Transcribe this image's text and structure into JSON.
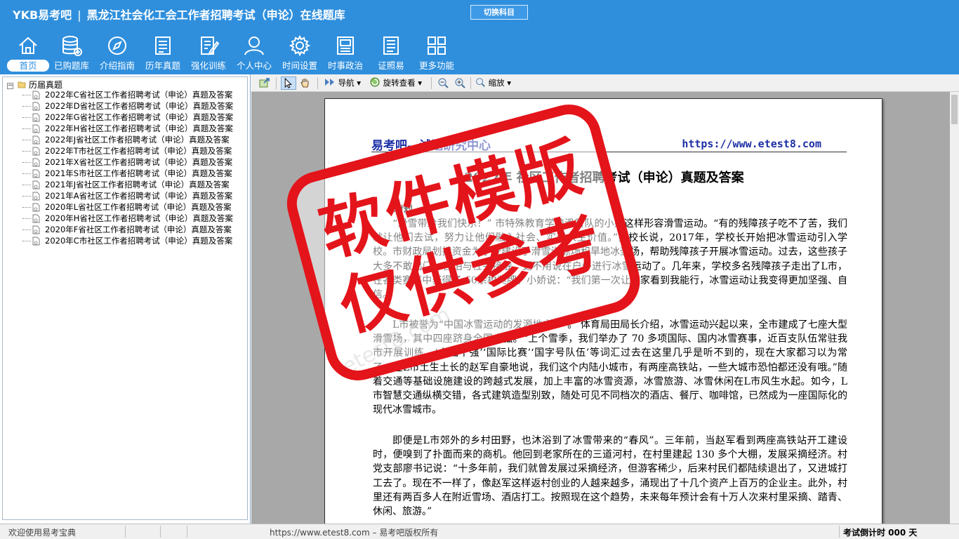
{
  "header": {
    "logo": "YKB易考吧",
    "title": "黑龙江社会化工会工作者招聘考试（申论）在线题库",
    "switch_label": "切换科目"
  },
  "nav": [
    {
      "label": "首页",
      "icon": "home-icon"
    },
    {
      "label": "已购题库",
      "icon": "database-icon"
    },
    {
      "label": "介绍指南",
      "icon": "compass-icon"
    },
    {
      "label": "历年真题",
      "icon": "document-list-icon"
    },
    {
      "label": "强化训练",
      "icon": "edit-icon"
    },
    {
      "label": "个人中心",
      "icon": "user-icon"
    },
    {
      "label": "时间设置",
      "icon": "gear-icon"
    },
    {
      "label": "时事政治",
      "icon": "news-icon"
    },
    {
      "label": "证照易",
      "icon": "certificate-icon"
    },
    {
      "label": "更多功能",
      "icon": "grid-icon"
    }
  ],
  "tree": {
    "root": "历届真题",
    "items": [
      "2022年C省社区工作者招聘考试（申论）真题及答案",
      "2022年D省社区工作者招聘考试（申论）真题及答案",
      "2022年G省社区工作者招聘考试（申论）真题及答案",
      "2022年H省社区工作者招聘考试（申论）真题及答案",
      "2022年J省社区工作者招聘考试（申论）真题及答案",
      "2022年T市社区工作者招聘考试（申论）真题及答案",
      "2021年X省社区工作者招聘考试（申论）真题及答案",
      "2021年S市社区工作者招聘考试（申论）真题及答案",
      "2021年J省社区工作者招聘考试（申论）真题及答案",
      "2021年A省社区工作者招聘考试（申论）真题及答案",
      "2020年L省社区工作者招聘考试（申论）真题及答案",
      "2020年H省社区工作者招聘考试（申论）真题及答案",
      "2020年F省社区工作者招聘考试（申论）真题及答案",
      "2020年C市社区工作者招聘考试（申论）真题及答案"
    ]
  },
  "toolbar": {
    "nav_label": "导航",
    "rotate_label": "旋转查看",
    "zoom_label": "缩放"
  },
  "document": {
    "brand": "易考吧—试题研究中心",
    "url": "https://www.etest8.com",
    "title": "2022年   社区工作者招聘考试（申论）真题及答案",
    "sub": "材料一",
    "paragraphs": [
      "“滑雪带给我们快乐！”    市特殊教育学校滑雪队的小娇这样形容滑雪运动。“有的残障孩子吃不了苦，我们就让他们去试，努力让他们融入社会、实现人生价值。”吴校长说，2017年，学校长开始把冰雪运动引入学校。市财政局划拨资金为学校建设了滑雪训练场和旱地冰壶场，帮助残障孩子开展冰雪运动。过去，这些孩子大多不敢出门，害怕与社会接触，更不用说在户外进行冰雪运动了。几年来，学校多名残障孩子走出了L市，在各类赛事中获得了 60余枚奖牌。小娇说：“我们第一次让大家看到我能行，冰雪运动让我变得更加坚强、自信。”",
      "L市被誉为“中国冰雪运动的发源地之一”。   体育局田局长介绍，冰雪运动兴起以来，全市建成了七座大型滑雪场，其中四座跻身全国十强。“上个雪季，我们举办了 70 多项国际、国内冰雪赛事，近百支队伍常驻我市开展训练。‘全国十强’‘国际比赛’‘国字号队伍’等词汇过去在这里几乎是听不到的，现在大家都习以为常了。”在L市土生土长的赵军自豪地说，我们这个内陆小城市，有两座高铁站，一些大城市恐怕都还没有哦。”随着交通等基础设施建设的跨越式发展，加上丰富的冰雪资源，冰雪旅游、冰雪休闲在L市风生水起。如今，L市智慧交通纵横交错，各式建筑造型别致，随处可见不同档次的酒店、餐厅、咖啡馆，已然成为一座国际化的现代冰雪城市。",
      "即便是L市郊外的乡村田野，也沐浴到了冰雪带来的“春风”。三年前，当赵军看到两座高铁站开工建设时，便嗅到了扑面而来的商机。他回到老家所在的三道河村，在村里建起 130 多个大棚，发展采摘经济。村党支部廖书记说：“十多年前，我们就曾发展过采摘经济，但游客稀少，后来村民们都陆续退出了，又进城打工去了。现在不一样了，像赵军这样返村创业的人越来越多，涌现出了十几个资产上百万的企业主。此外，村里还有两百多人在附近雪场、酒店打工。按照现在这个趋势，未来每年预计会有十万人次来村里采摘、踏青、休闲、旅游。”"
    ]
  },
  "stamp": {
    "line1": "软件模版",
    "line2": "仅供参考",
    "color": "#e4141b"
  },
  "watermark": "etest8.com",
  "status": {
    "left": "欢迎使用易考宝典",
    "center": "https://www.etest8.com – 易考吧版权所有",
    "right": "考试倒计时 000 天"
  },
  "colors": {
    "header_bg": "#2f8fdd",
    "brand_text": "#1c2fa5"
  }
}
